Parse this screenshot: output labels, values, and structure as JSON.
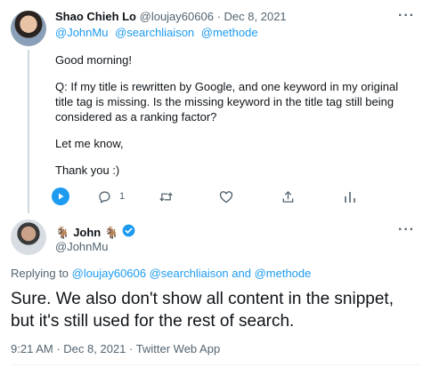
{
  "tweet1": {
    "author_name": "Shao Chieh Lo",
    "handle": "@loujay60606",
    "separator": "·",
    "date": "Dec 8, 2021",
    "more": "···",
    "mentions": [
      "@JohnMu",
      "@searchliaison",
      "@methode"
    ],
    "paragraphs": [
      "Good morning!",
      "Q: If my title is rewritten by Google, and one keyword in my original title tag is missing. Is the missing keyword in the title tag still being considered as a ranking factor?",
      "Let me know,",
      "Thank you :)"
    ],
    "actions": {
      "reply_count": "1",
      "play_icon": "play-icon",
      "reply_icon": "reply-icon",
      "retweet_icon": "retweet-icon",
      "like_icon": "heart-icon",
      "share_icon": "share-icon",
      "analytics_icon": "analytics-icon"
    }
  },
  "tweet2": {
    "display_name": "John",
    "goat_emoji": "🐐",
    "verified_icon": "verified-badge-icon",
    "handle": "@JohnMu",
    "more": "···",
    "replying_prefix": "Replying to",
    "replying_to": "@loujay60606 @searchliaison and @methode",
    "text": "Sure. We also don't show all content in the snippet, but it's still used for the rest of search.",
    "time": "9:21 AM",
    "date": "Dec 8, 2021",
    "source": "Twitter Web App",
    "separator": "·"
  },
  "colors": {
    "accent": "#1d9bf0",
    "muted": "#536471",
    "text": "#0f1419",
    "thread_line": "#cfd9de"
  }
}
